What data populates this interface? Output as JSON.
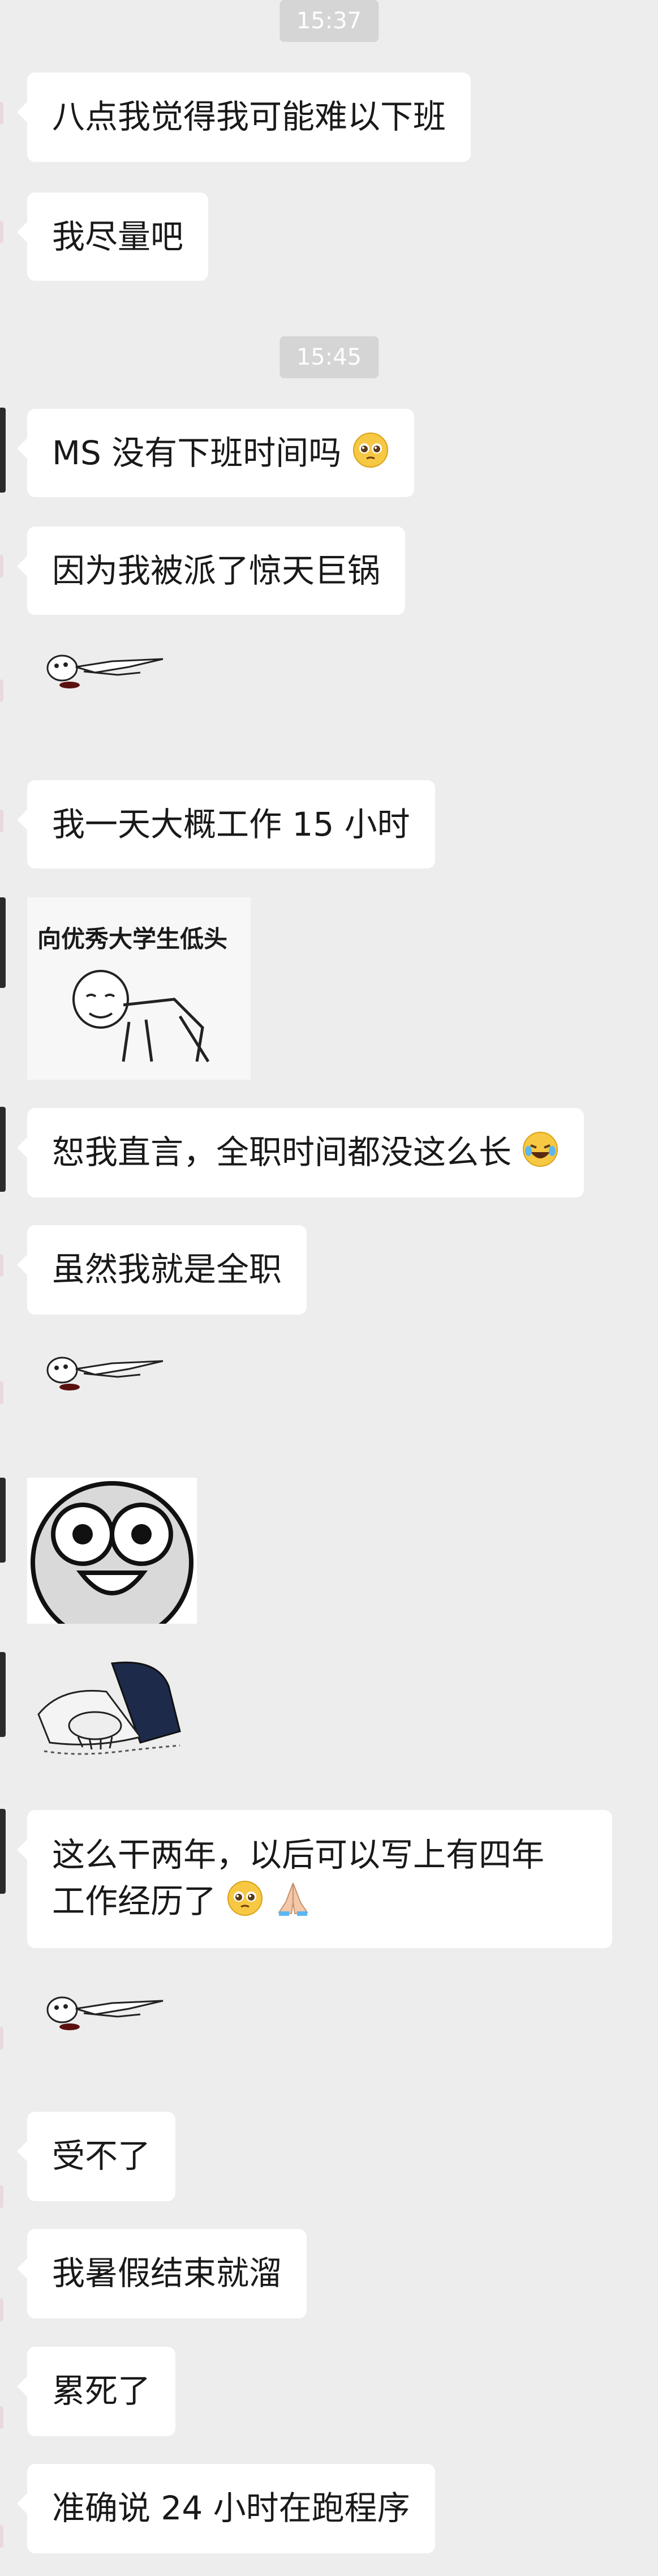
{
  "timestamps": [
    "15:37",
    "15:45"
  ],
  "messages": {
    "m1": "八点我觉得我可能难以下班",
    "m2": "我尽量吧",
    "m3": "MS 没有下班时间吗",
    "m4": "因为我被派了惊天巨锅",
    "m5": "我一天大概工作 15 小时",
    "m6": "恕我直言，全职时间都没这么长",
    "m7": "虽然我就是全职",
    "m8_line1": "这么干两年，以后可以写上有四年",
    "m8_line2": "工作经历了",
    "m9": "受不了",
    "m10": "我暑假结束就溜",
    "m11": "累死了",
    "m12": "准确说 24 小时在跑程序"
  },
  "meme_caption": "向优秀大学生低头",
  "icons": {
    "pleading": "pleading-face-emoji",
    "laugh_cry": "rolling-laughing-emoji",
    "pray": "folded-hands-emoji",
    "lying": "lying-figure-sticker",
    "kneel": "kneeling-meme-sticker",
    "face": "wide-eyed-face-sticker",
    "prostrate": "prostrating-sticker"
  },
  "colors": {
    "background": "#ededed",
    "bubble": "#ffffff",
    "text": "#191919",
    "timestamp_bg": "#d5d5d5"
  }
}
